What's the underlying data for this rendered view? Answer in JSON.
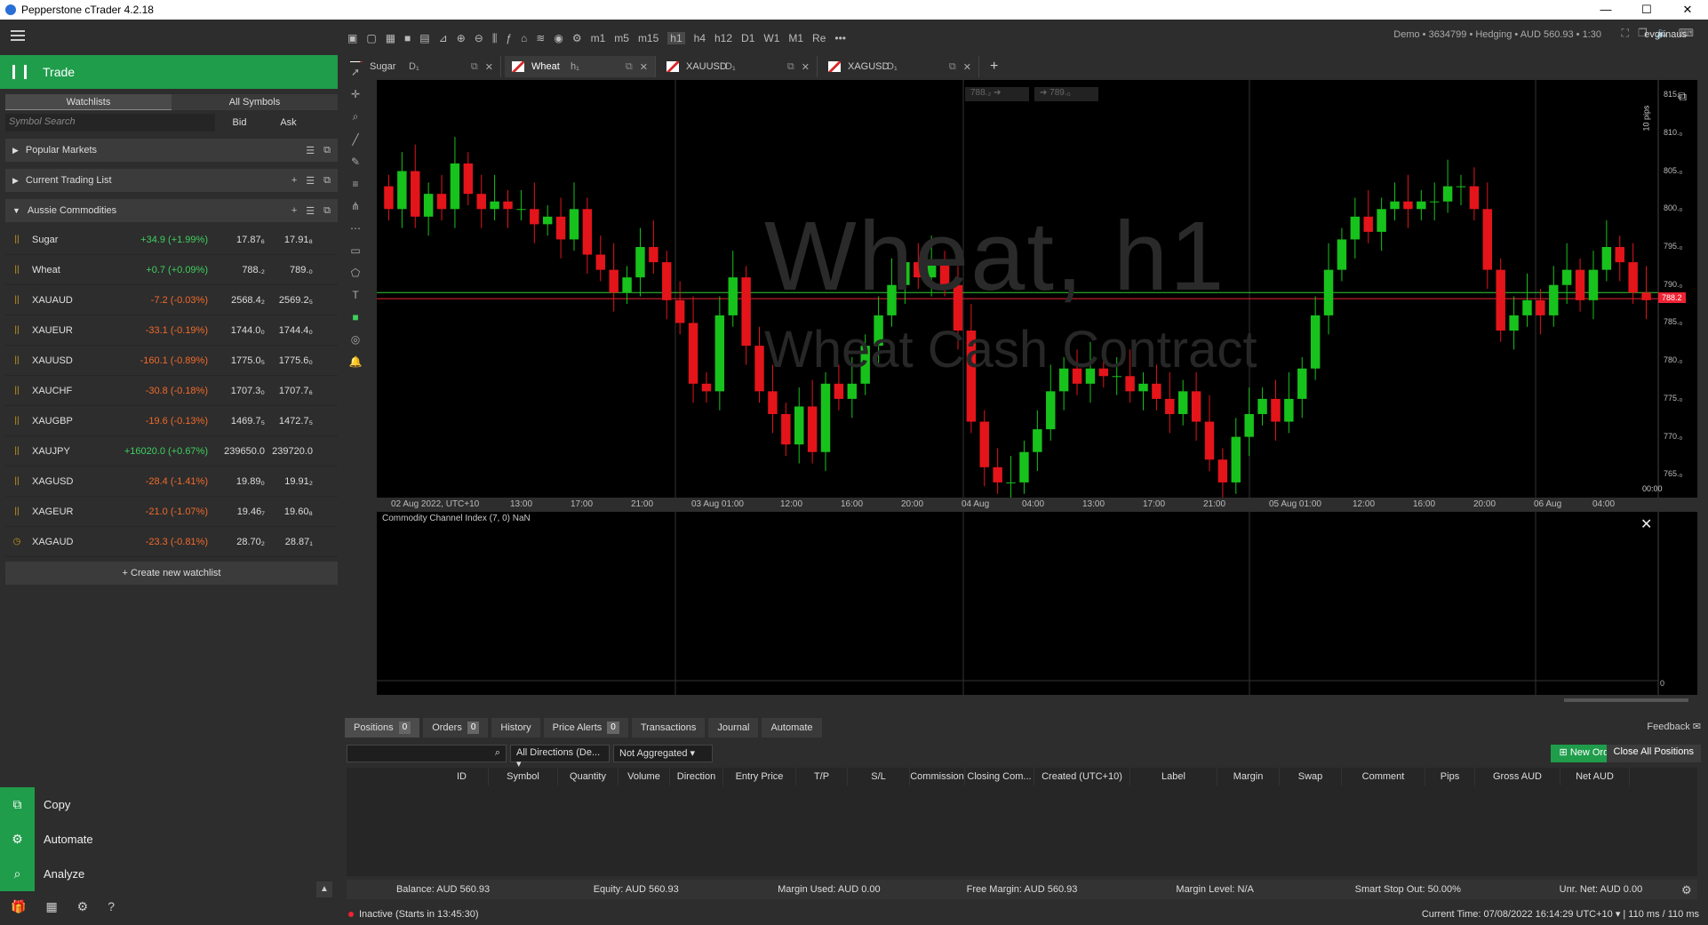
{
  "window": {
    "title": "Pepperstone cTrader 4.2.18",
    "min": "—",
    "max": "☐",
    "close": "✕"
  },
  "account": {
    "summary": "Demo • 3634799 • Hedging • AUD 560.93 • 1:30",
    "user": "evgrinaus"
  },
  "sidebar": {
    "trade_label": "Trade",
    "watchlist_tabs": [
      "Watchlists",
      "All Symbols"
    ],
    "search_placeholder": "Symbol Search",
    "col_bid": "Bid",
    "col_ask": "Ask",
    "groups": [
      "Popular Markets",
      "Current Trading List",
      "Aussie Commodities"
    ],
    "rows": [
      {
        "sym": "Sugar",
        "chg": "+34.9 (+1.99%)",
        "dir": "pos",
        "bid": "17.87₆",
        "ask": "17.91₈"
      },
      {
        "sym": "Wheat",
        "chg": "+0.7 (+0.09%)",
        "dir": "pos",
        "bid": "788.₂",
        "ask": "789.₀"
      },
      {
        "sym": "XAUAUD",
        "chg": "-7.2 (-0.03%)",
        "dir": "neg",
        "bid": "2568.4₂",
        "ask": "2569.2₅"
      },
      {
        "sym": "XAUEUR",
        "chg": "-33.1 (-0.19%)",
        "dir": "neg",
        "bid": "1744.0₀",
        "ask": "1744.4₀"
      },
      {
        "sym": "XAUUSD",
        "chg": "-160.1 (-0.89%)",
        "dir": "neg",
        "bid": "1775.0₅",
        "ask": "1775.6₀"
      },
      {
        "sym": "XAUCHF",
        "chg": "-30.8 (-0.18%)",
        "dir": "neg",
        "bid": "1707.3₀",
        "ask": "1707.7₆"
      },
      {
        "sym": "XAUGBP",
        "chg": "-19.6 (-0.13%)",
        "dir": "neg",
        "bid": "1469.7₅",
        "ask": "1472.7₅"
      },
      {
        "sym": "XAUJPY",
        "chg": "+16020.0 (+0.67%)",
        "dir": "pos",
        "bid": "239650.0",
        "ask": "239720.0"
      },
      {
        "sym": "XAGUSD",
        "chg": "-28.4 (-1.41%)",
        "dir": "neg",
        "bid": "19.89₀",
        "ask": "19.91₂"
      },
      {
        "sym": "XAGEUR",
        "chg": "-21.0 (-1.07%)",
        "dir": "neg",
        "bid": "19.46₇",
        "ask": "19.60₈"
      },
      {
        "sym": "XAGAUD",
        "chg": "-23.3 (-0.81%)",
        "dir": "neg",
        "bid": "28.70₂",
        "ask": "28.87₁"
      }
    ],
    "create_watchlist": "+ Create new watchlist",
    "actions": [
      "Copy",
      "Automate",
      "Analyze"
    ]
  },
  "toolbar": {
    "timeframes": [
      "m1",
      "m5",
      "m15",
      "h1",
      "h4",
      "h12",
      "D1",
      "W1",
      "M1",
      "Re"
    ]
  },
  "chart_tabs": [
    {
      "symbol": "Sugar",
      "tf": "D₁"
    },
    {
      "symbol": "Wheat",
      "tf": "h₁"
    },
    {
      "symbol": "XAUUSD",
      "tf": "D₁"
    },
    {
      "symbol": "XAGUSD",
      "tf": "D₁"
    }
  ],
  "chart": {
    "watermark_title": "Wheat, h1",
    "watermark_sub": "Wheat Cash Contract",
    "bid_box": "788.₂",
    "ask_box": "789.₀",
    "pips_label": "10 pips",
    "price_ticks": [
      "815.₀",
      "810.₀",
      "805.₀",
      "800.₀",
      "795.₀",
      "790.₀",
      "785.₀",
      "780.₀",
      "775.₀",
      "770.₀",
      "765.₀"
    ],
    "current_price": "788.2",
    "time_ticks": [
      "02 Aug 2022, UTC+10",
      "13:00",
      "17:00",
      "21:00",
      "03 Aug 01:00",
      "12:00",
      "16:00",
      "20:00",
      "04 Aug",
      "04:00",
      "13:00",
      "17:00",
      "21:00",
      "05 Aug 01:00",
      "12:00",
      "16:00",
      "20:00",
      "06 Aug",
      "04:00"
    ],
    "countdown": "00:00",
    "indicator_label": "Commodity Channel Index (7, 0) NaN",
    "indicator_zero": "0"
  },
  "bottom": {
    "tabs": [
      {
        "label": "Positions",
        "count": "0"
      },
      {
        "label": "Orders",
        "count": "0"
      },
      {
        "label": "History"
      },
      {
        "label": "Price Alerts",
        "count": "0"
      },
      {
        "label": "Transactions"
      },
      {
        "label": "Journal"
      },
      {
        "label": "Automate"
      }
    ],
    "feedback": "Feedback",
    "direction_filter": "All Directions (De...",
    "aggregation": "Not Aggregated",
    "new_order": "New Order",
    "close_all": "Close All Positions",
    "columns": [
      "ID",
      "Symbol",
      "Quantity",
      "Volume",
      "Direction",
      "Entry Price",
      "T/P",
      "S/L",
      "Commission",
      "Closing Com...",
      "Created (UTC+10)",
      "Label",
      "Margin",
      "Swap",
      "Comment",
      "Pips",
      "Gross AUD",
      "Net AUD"
    ],
    "status": [
      "Balance: AUD 560.93",
      "Equity: AUD 560.93",
      "Margin Used: AUD 0.00",
      "Free Margin: AUD 560.93",
      "Margin Level: N/A",
      "Smart Stop Out: 50.00%",
      "Unr. Net: AUD 0.00"
    ],
    "inactive": "Inactive (Starts in 13:45:30)",
    "current_time": "Current Time: 07/08/2022 16:14:29  UTC+10  ▾  |  110 ms / 110 ms"
  }
}
